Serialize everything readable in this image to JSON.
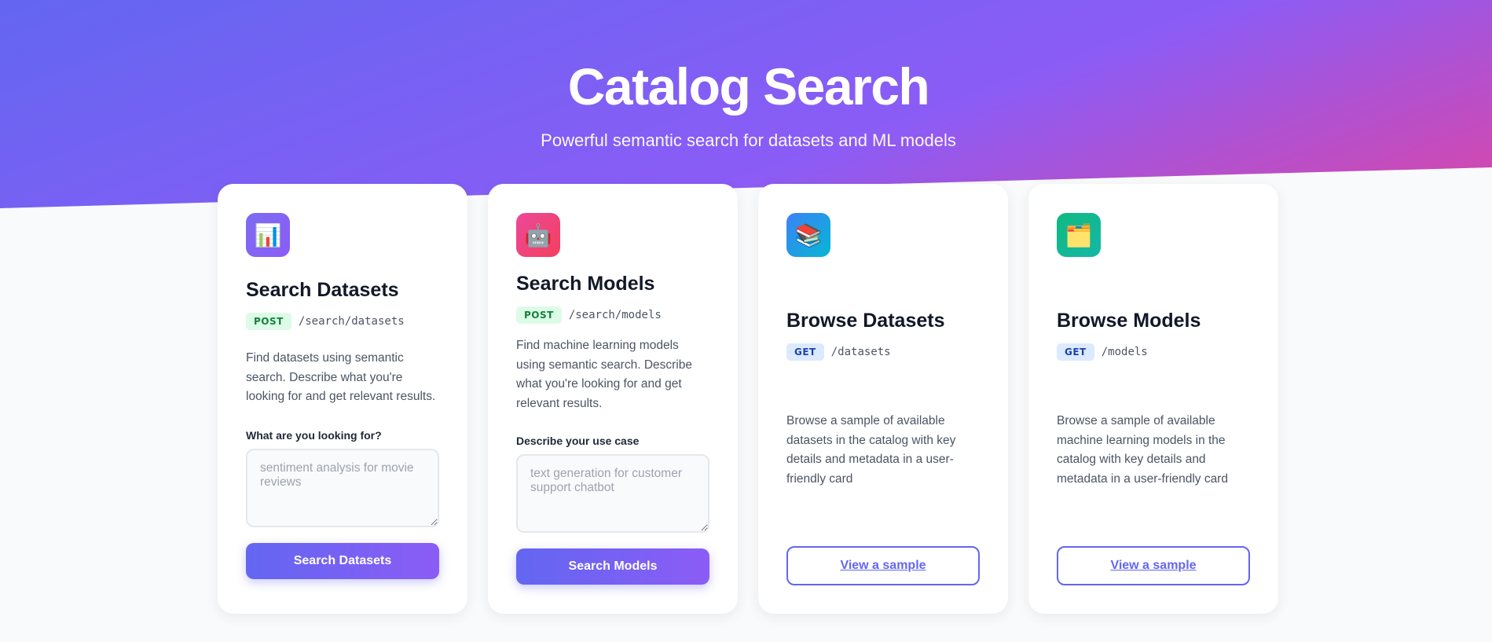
{
  "hero": {
    "title": "Catalog Search",
    "subtitle": "Powerful semantic search for datasets and ML models"
  },
  "cards": [
    {
      "icon": "bar-chart-icon",
      "icon_glyph": "📊",
      "icon_color": "#8b5cf6",
      "title": "Search Datasets",
      "method": "POST",
      "path": "/search/datasets",
      "description": "Find datasets using semantic search. Describe what you're looking for and get relevant results.",
      "field_label": "What are you looking for?",
      "placeholder": "sentiment analysis for movie reviews",
      "button": "Search Datasets"
    },
    {
      "icon": "robot-icon",
      "icon_glyph": "🤖",
      "icon_color": "#ec4899",
      "title": "Search Models",
      "method": "POST",
      "path": "/search/models",
      "description": "Find machine learning models using semantic search. Describe what you're looking for and get relevant results.",
      "field_label": "Describe your use case",
      "placeholder": "text generation for customer support chatbot",
      "button": "Search Models"
    },
    {
      "icon": "books-icon",
      "icon_glyph": "📚",
      "icon_color": "#3b82f6",
      "title": "Browse Datasets",
      "method": "GET",
      "path": "/datasets",
      "description": "Browse a sample of available datasets in the catalog with key details and metadata in a user-friendly card",
      "button": "View a sample"
    },
    {
      "icon": "folder-icon",
      "icon_glyph": "🗂️",
      "icon_color": "#10b981",
      "title": "Browse Models",
      "method": "GET",
      "path": "/models",
      "description": "Browse a sample of available machine learning models in the catalog with key details and metadata in a user-friendly card",
      "button": "View a sample"
    }
  ]
}
